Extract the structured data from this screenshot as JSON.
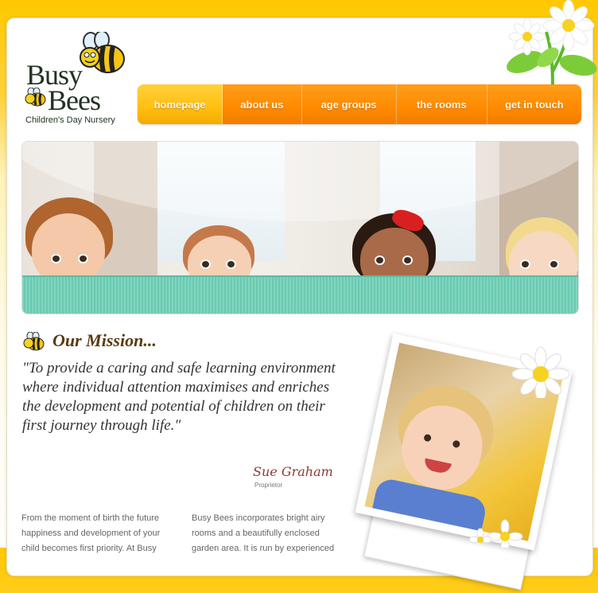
{
  "brand": {
    "name_line1": "Busy",
    "name_line2": "Bees",
    "tagline": "Children's Day Nursery"
  },
  "nav": {
    "items": [
      {
        "label": "homepage",
        "active": true
      },
      {
        "label": "about us",
        "active": false
      },
      {
        "label": "age groups",
        "active": false
      },
      {
        "label": "the rooms",
        "active": false
      },
      {
        "label": "get in touch",
        "active": false
      }
    ]
  },
  "mission": {
    "title": "Our Mission...",
    "quote": "\"To provide a caring and safe learning environment where individual attention maximises and enriches the development and potential of children on their first journey through life.\"",
    "signature": "Sue Graham",
    "signature_role": "Proprietor"
  },
  "columns": {
    "left": "From the moment of birth the future happiness and development of your child becomes first priority. At Busy",
    "right": "Busy Bees incorporates bright airy rooms and a beautifully enclosed garden area. It is run by experienced"
  },
  "colors": {
    "accent": "#ff8a00",
    "active_tab": "#ffbf10",
    "banner": "#ffc800"
  }
}
